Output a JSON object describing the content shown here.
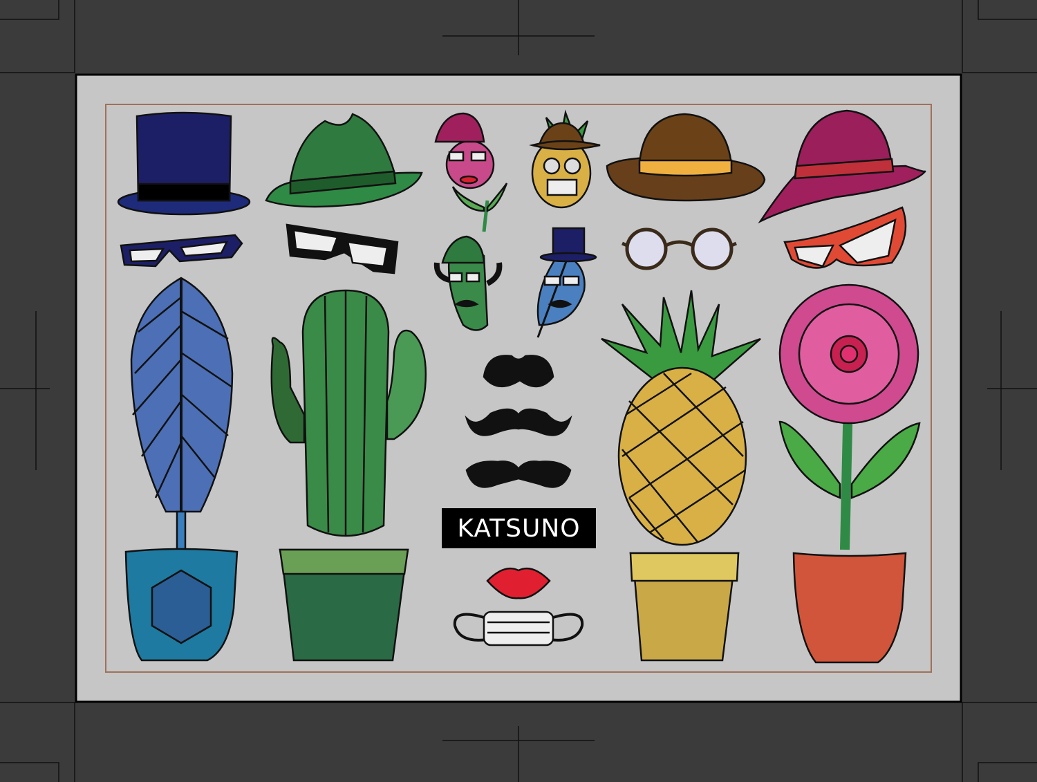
{
  "nameplate": {
    "text": "KATSUNO"
  },
  "colors": {
    "background": "#3b3b3b",
    "sheet": "#c6c6c6",
    "inner_border": "#a0705a",
    "top_hat": "#1d1f66",
    "fedora": "#2f7a3e",
    "bowler": "#673f1a",
    "sun_hat": "#9a1f5a"
  }
}
